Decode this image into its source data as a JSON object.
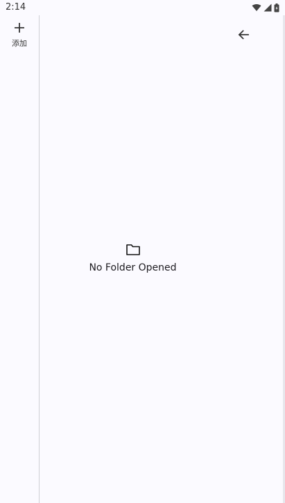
{
  "status_bar": {
    "time": "2:14",
    "icons": [
      "wifi-icon",
      "signal-icon",
      "battery-icon"
    ]
  },
  "drawer": {
    "add_label": "添加",
    "add_icon": "plus-icon"
  },
  "toolbar": {
    "back_icon": "arrow-left-icon"
  },
  "empty_state": {
    "icon": "folder-icon",
    "message": "No Folder Opened"
  },
  "colors": {
    "background": "#fbfaff",
    "divider": "#cfcfd4",
    "text": "#1d1b20"
  }
}
